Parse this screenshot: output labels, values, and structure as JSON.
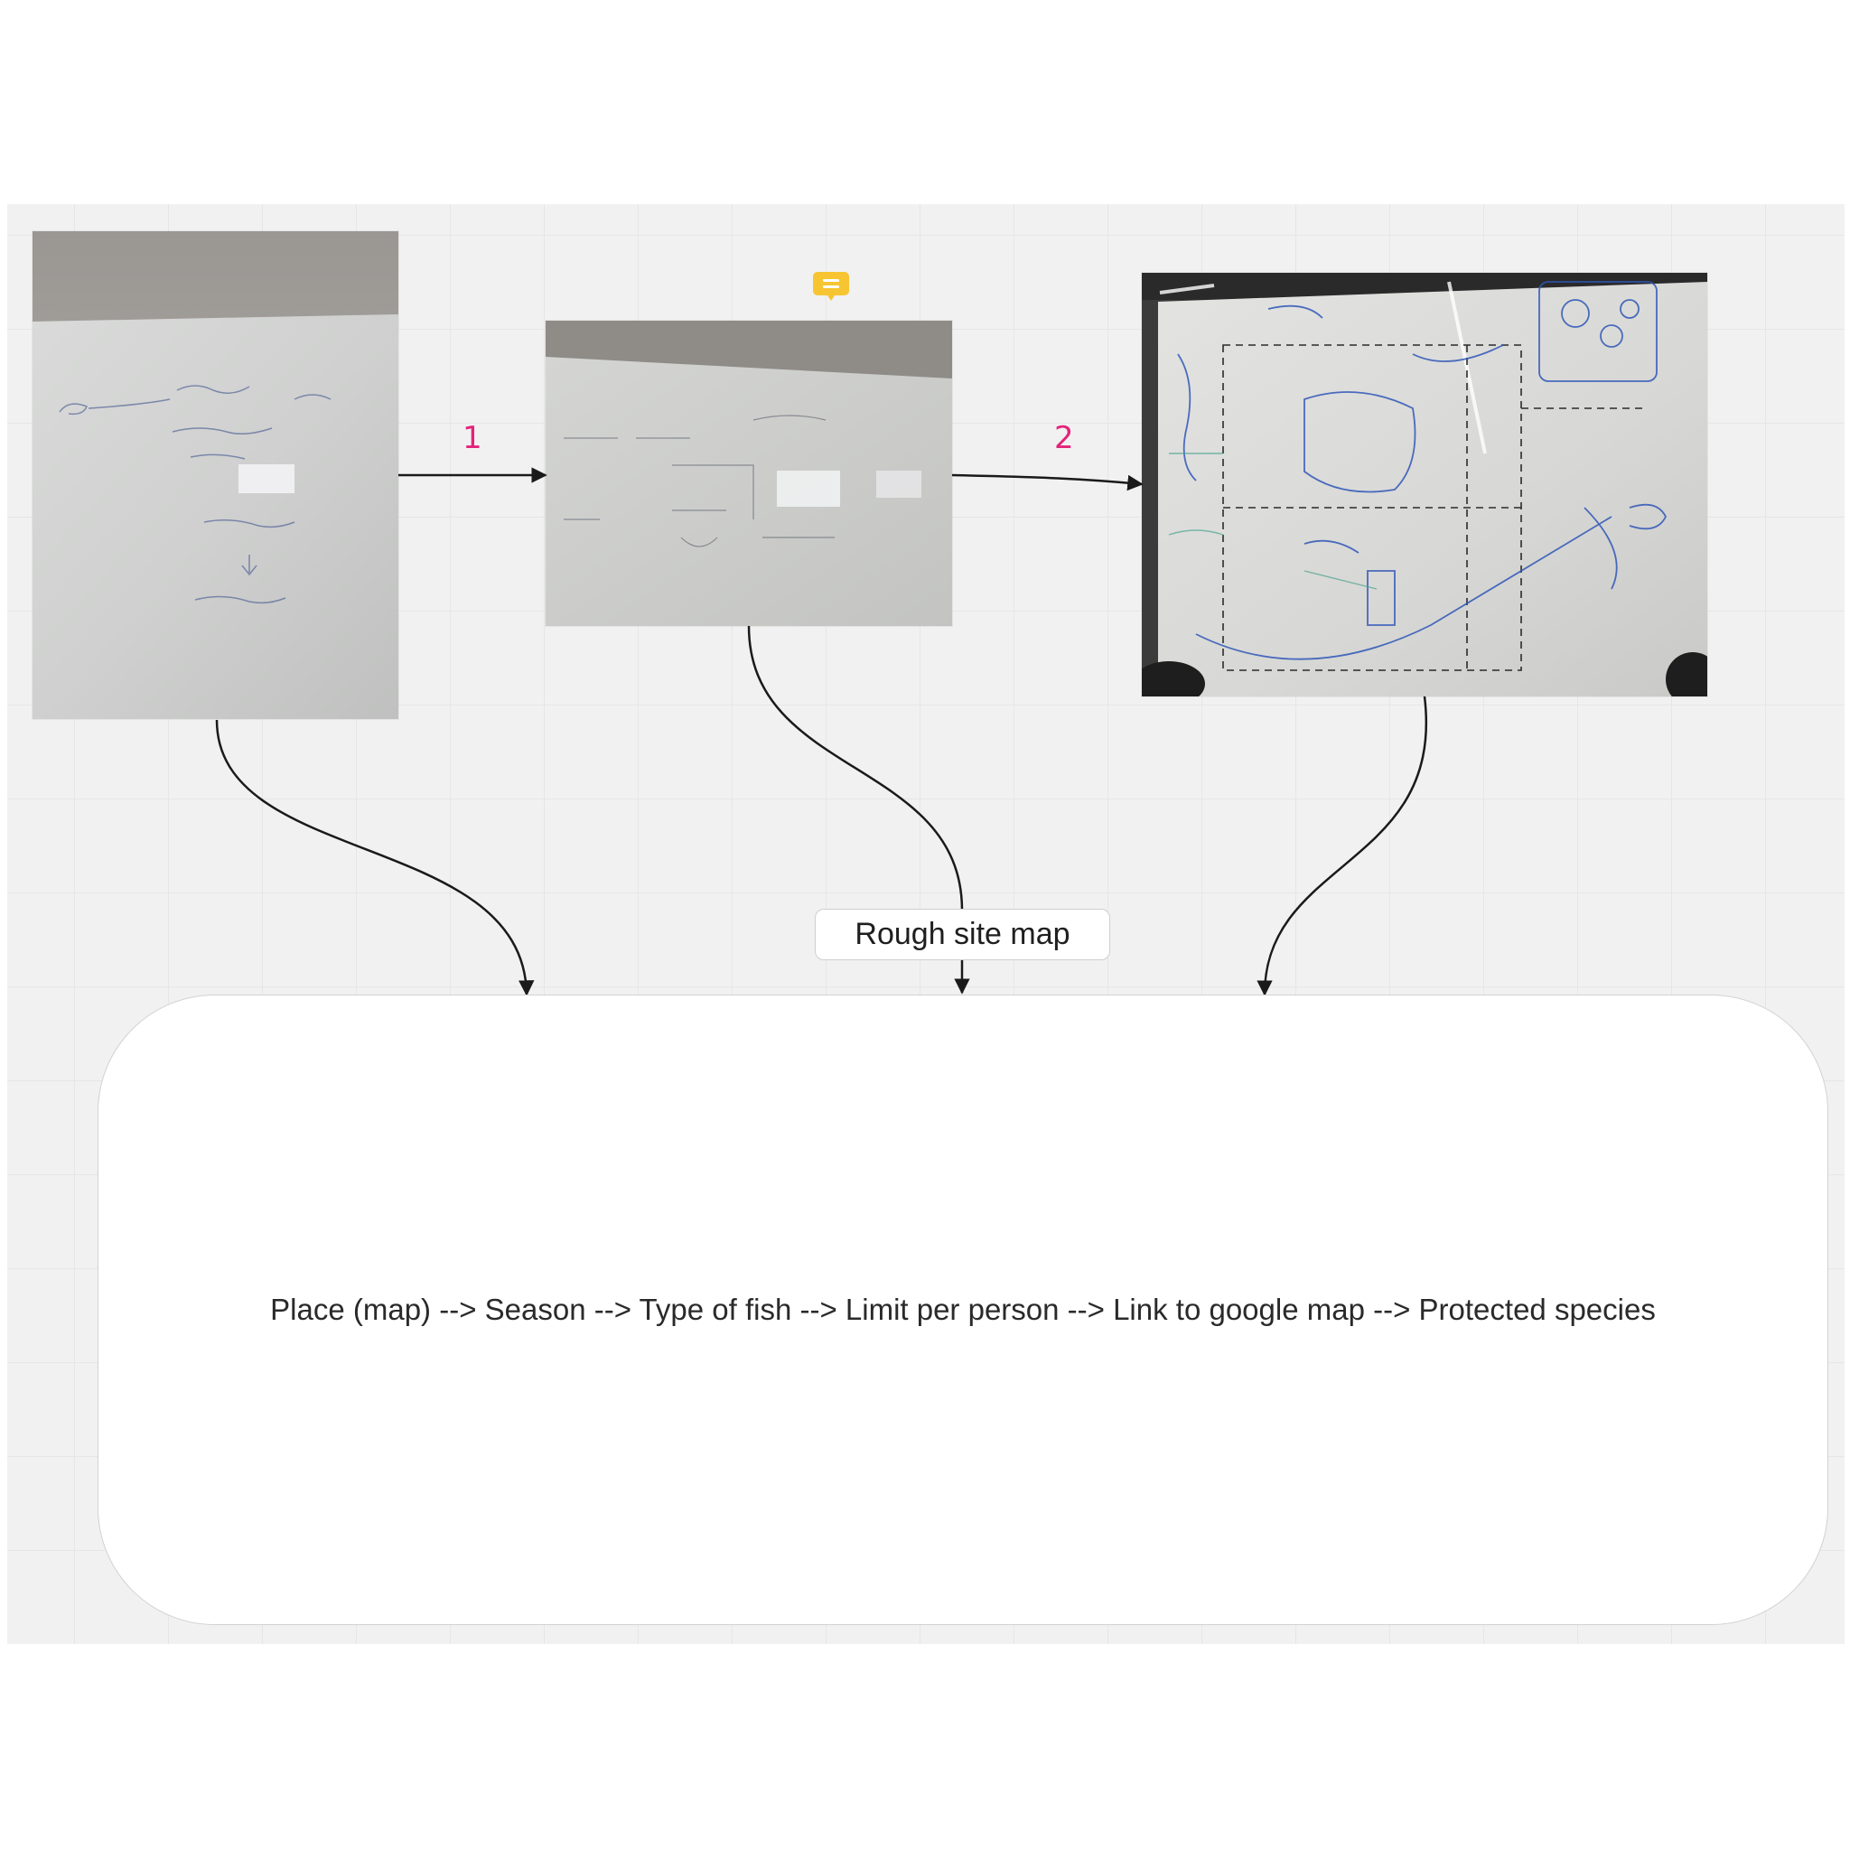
{
  "photos": [
    {
      "name": "whiteboard-photo-left",
      "description_icon": "whiteboard-photo"
    },
    {
      "name": "whiteboard-photo-middle",
      "description_icon": "whiteboard-photo"
    },
    {
      "name": "whiteboard-photo-right",
      "description_icon": "whiteboard-photo"
    }
  ],
  "steps": {
    "step1_label": "1",
    "step2_label": "2"
  },
  "site_map_label": "Rough site map",
  "flow_text": "Place (map) --> Season --> Type of fish --> Limit per person --> Link to google map --> Protected species",
  "colors": {
    "step_label": "#e3237a",
    "comment_icon": "#f6c531",
    "board_background": "#f1f1f1",
    "connector": "#1a1a1a"
  },
  "icons": {
    "comment": "comment-icon"
  }
}
